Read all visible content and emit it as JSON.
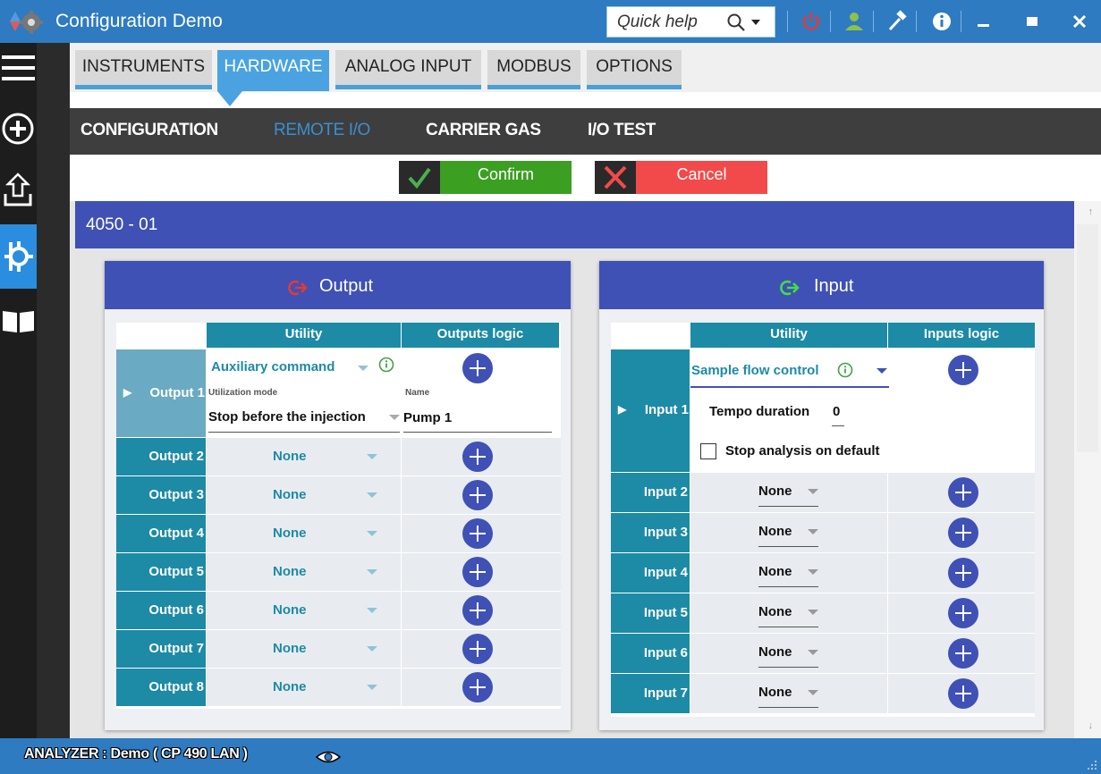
{
  "window": {
    "title": "Configuration Demo"
  },
  "quick_help": {
    "placeholder": "Quick help"
  },
  "top_tabs": [
    {
      "label": "INSTRUMENTS",
      "active": false
    },
    {
      "label": "HARDWARE",
      "active": true
    },
    {
      "label": "ANALOG INPUT",
      "active": false
    },
    {
      "label": "MODBUS",
      "active": false
    },
    {
      "label": "OPTIONS",
      "active": false
    }
  ],
  "sub_tabs": [
    {
      "label": "CONFIGURATION",
      "active": false
    },
    {
      "label": "REMOTE I/O",
      "active": true
    },
    {
      "label": "CARRIER GAS",
      "active": false
    },
    {
      "label": "I/O TEST",
      "active": false
    }
  ],
  "actions": {
    "confirm": "Confirm",
    "cancel": "Cancel",
    "confirm_color": "#3b9f22",
    "cancel_color": "#f24a4a"
  },
  "device": {
    "title": "4050 - 01"
  },
  "output_panel": {
    "title": "Output",
    "col_utility": "Utility",
    "col_logic": "Outputs logic",
    "expanded": {
      "label": "Output 1",
      "utility": "Auxiliary command",
      "mode_label": "Utilization mode",
      "mode_value": "Stop before the injection",
      "name_label": "Name",
      "name_value": "Pump 1"
    },
    "rows": [
      {
        "label": "Output 2",
        "utility": "None"
      },
      {
        "label": "Output 3",
        "utility": "None"
      },
      {
        "label": "Output 4",
        "utility": "None"
      },
      {
        "label": "Output 5",
        "utility": "None"
      },
      {
        "label": "Output 6",
        "utility": "None"
      },
      {
        "label": "Output 7",
        "utility": "None"
      },
      {
        "label": "Output 8",
        "utility": "None"
      }
    ]
  },
  "input_panel": {
    "title": "Input",
    "col_utility": "Utility",
    "col_logic": "Inputs logic",
    "expanded": {
      "label": "Input 1",
      "utility": "Sample flow control",
      "tempo_label": "Tempo duration",
      "tempo_value": "0",
      "stop_label": "Stop analysis on default",
      "stop_checked": false
    },
    "rows": [
      {
        "label": "Input 2",
        "utility": "None"
      },
      {
        "label": "Input 3",
        "utility": "None"
      },
      {
        "label": "Input 4",
        "utility": "None"
      },
      {
        "label": "Input 5",
        "utility": "None"
      },
      {
        "label": "Input 6",
        "utility": "None"
      },
      {
        "label": "Input 7",
        "utility": "None"
      }
    ]
  },
  "status": {
    "text": "ANALYZER : Demo ( CP 490 LAN )"
  },
  "colors": {
    "titlebar": "#2e7bc1",
    "accent": "#3f51b5",
    "teal": "#1d8aa6",
    "tab_active": "#4aa3e0"
  }
}
